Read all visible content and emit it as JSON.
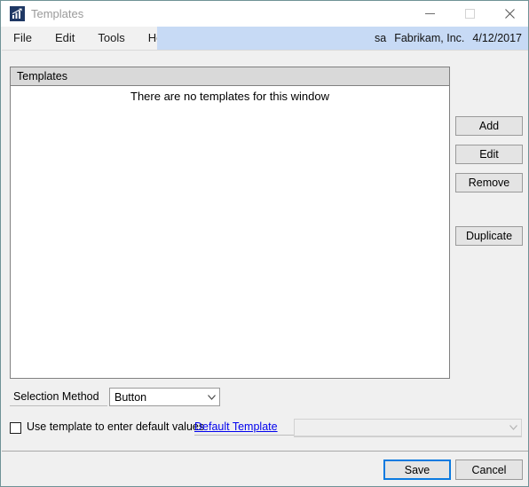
{
  "window": {
    "title": "Templates",
    "icon": "chart-app-icon",
    "controls": {
      "minimize": "minimize-icon",
      "maximize": "maximize-icon",
      "close": "close-icon"
    }
  },
  "menubar": {
    "items": [
      {
        "label": "File"
      },
      {
        "label": "Edit"
      },
      {
        "label": "Tools"
      },
      {
        "label": "Help"
      }
    ],
    "status": {
      "user": "sa",
      "company": "Fabrikam, Inc.",
      "date": "4/12/2017"
    }
  },
  "templates_group": {
    "header": "Templates",
    "empty_message": "There are no templates for this window",
    "items": []
  },
  "side_buttons": [
    {
      "label": "Add",
      "name": "add-button"
    },
    {
      "label": "Edit",
      "name": "edit-button"
    },
    {
      "label": "Remove",
      "name": "remove-button"
    },
    {
      "label": "Duplicate",
      "name": "duplicate-button"
    }
  ],
  "selection_method": {
    "label": "Selection Method",
    "value": "Button",
    "placeholder": ""
  },
  "default_values": {
    "checkbox_label": "Use template to enter default values",
    "checked": false,
    "link_label": "Default Template",
    "template_combo_value": "",
    "template_combo_placeholder": "",
    "template_combo_enabled": false
  },
  "footer": {
    "save_label": "Save",
    "cancel_label": "Cancel"
  },
  "colors": {
    "window_border": "#6f9296",
    "status_strip": "#c7daf5",
    "app_icon": "#1f3864",
    "link": "#0000ee",
    "default_button_focus": "#0a7ae0",
    "group_header": "#d9d9d9",
    "surface": "#f0f0f0"
  }
}
